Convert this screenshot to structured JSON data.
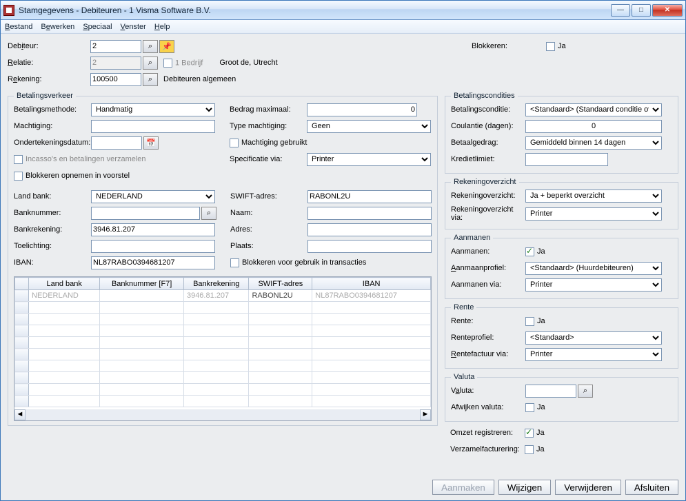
{
  "window": {
    "title": "Stamgegevens - Debiteuren - 1 Visma Software B.V."
  },
  "menu": {
    "bestand": "Bestand",
    "bewerken": "Bewerken",
    "speciaal": "Speciaal",
    "venster": "Venster",
    "help": "Help"
  },
  "top": {
    "debiteur_label": "Debiteur:",
    "debiteur_value": "2",
    "relatie_label": "Relatie:",
    "relatie_value": "2",
    "bedrijf_label": "1 Bedrijf",
    "relatie_text": "Groot de, Utrecht",
    "rekening_label": "Rekening:",
    "rekening_value": "100500",
    "rekening_text": "Debiteuren algemeen",
    "blokkeren_label": "Blokkeren:",
    "ja": "Ja"
  },
  "betalingsverkeer": {
    "legend": "Betalingsverkeer",
    "methode_label": "Betalingsmethode:",
    "methode_value": "Handmatig",
    "machtiging_label": "Machtiging:",
    "machtiging_value": "",
    "ondertek_label": "Ondertekeningsdatum:",
    "ondertek_value": "",
    "incasso_label": "Incasso's en betalingen verzamelen",
    "blokkeren_voorstel_label": "Blokkeren opnemen in voorstel",
    "bedrag_label": "Bedrag maximaal:",
    "bedrag_value": "0",
    "type_machtiging_label": "Type machtiging:",
    "type_machtiging_value": "Geen",
    "machtiging_gebruikt_label": "Machtiging gebruikt",
    "specificatie_label": "Specificatie via:",
    "specificatie_value": "Printer",
    "landbank_label": "Land bank:",
    "landbank_value": "NEDERLAND",
    "banknummer_label": "Banknummer:",
    "banknummer_value": "",
    "bankrekening_label": "Bankrekening:",
    "bankrekening_value": "3946.81.207",
    "toelichting_label": "Toelichting:",
    "toelichting_value": "",
    "iban_label": "IBAN:",
    "iban_value": "NL87RABO0394681207",
    "swift_label": "SWIFT-adres:",
    "swift_value": "RABONL2U",
    "naam_label": "Naam:",
    "naam_value": "",
    "adres_label": "Adres:",
    "adres_value": "",
    "plaats_label": "Plaats:",
    "plaats_value": "",
    "blok_trans_label": "Blokkeren voor gebruik in transacties",
    "grid_cols": {
      "c0": "",
      "c1": "Land bank",
      "c2": "Banknummer [F7]",
      "c3": "Bankrekening",
      "c4": "SWIFT-adres",
      "c5": "IBAN"
    },
    "grid_row": {
      "c1": "NEDERLAND",
      "c2": "",
      "c3": "3946.81.207",
      "c4": "RABONL2U",
      "c5": "NL87RABO0394681207"
    }
  },
  "condities": {
    "legend": "Betalingscondities",
    "cond_label": "Betalingsconditie:",
    "cond_value": "<Standaard> (Standaard conditie ove",
    "coulantie_label": "Coulantie (dagen):",
    "coulantie_value": "0",
    "gedrag_label": "Betaalgedrag:",
    "gedrag_value": "Gemiddeld binnen 14 dagen",
    "kredietlimiet_label": "Kredietlimiet:",
    "kredietlimiet_value": ""
  },
  "rekov": {
    "legend": "Rekeningoverzicht",
    "label": "Rekeningoverzicht:",
    "value": "Ja + beperkt overzicht",
    "via_label": "Rekeningoverzicht via:",
    "via_value": "Printer"
  },
  "aanmanen": {
    "legend": "Aanmanen",
    "label": "Aanmanen:",
    "ja": "Ja",
    "profiel_label": "Aanmaanprofiel:",
    "profiel_value": "<Standaard> (Huurdebiteuren)",
    "via_label": "Aanmanen via:",
    "via_value": "Printer"
  },
  "rente": {
    "legend": "Rente",
    "label": "Rente:",
    "ja": "Ja",
    "profiel_label": "Renteprofiel:",
    "profiel_value": "<Standaard>",
    "factuur_label": "Rentefactuur via:",
    "factuur_value": "Printer"
  },
  "valuta": {
    "legend": "Valuta",
    "label": "Valuta:",
    "value": "",
    "afwijken_label": "Afwijken valuta:",
    "ja": "Ja"
  },
  "omzet": {
    "label": "Omzet registreren:",
    "ja": "Ja"
  },
  "verzamel": {
    "label": "Verzamelfacturering:",
    "ja": "Ja"
  },
  "buttons": {
    "aanmaken": "Aanmaken",
    "wijzigen": "Wijzigen",
    "verwijderen": "Verwijderen",
    "afsluiten": "Afsluiten"
  }
}
